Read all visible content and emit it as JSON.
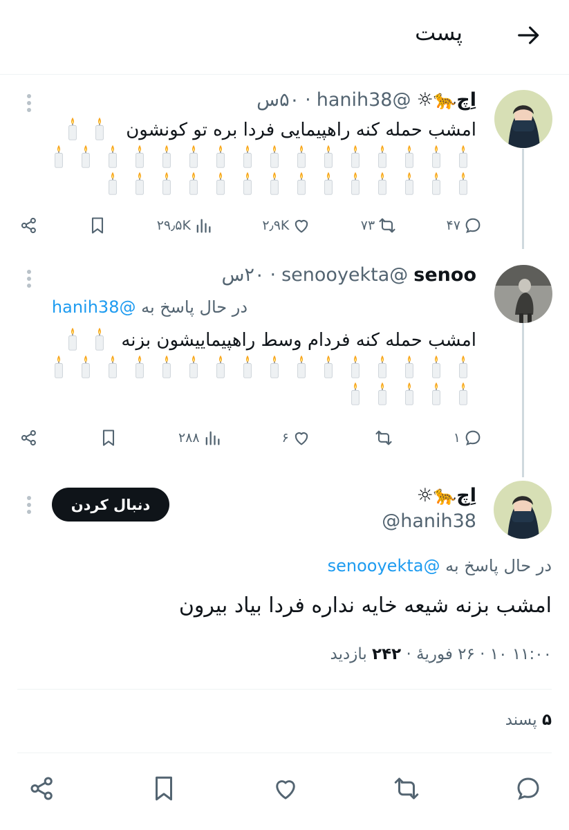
{
  "header": {
    "title": "پست"
  },
  "tweet1": {
    "display_name": "اِچ🐆☼",
    "handle": "@hanih38",
    "time": "۵۰س",
    "text": "امشب حمله کنه راهپیمایی فردا بره تو کونشون",
    "candle_glyph": "🕯️",
    "candle_count": 32,
    "stats": {
      "replies": "۴۷",
      "retweets": "۷۳",
      "likes": "۲٫۹K",
      "views": "۲۹٫۵K"
    }
  },
  "tweet2": {
    "display_name": "senoo",
    "handle": "@senooyekta",
    "time": "۲۰س",
    "reply_prefix": "در حال پاسخ به",
    "reply_to": "@hanih38",
    "text": "امشب حمله کنه فردام وسط راهپیماییشون بزنه",
    "candle_count": 23,
    "stats": {
      "replies": "۱",
      "retweets": "",
      "likes": "۶",
      "views": "۲۸۸"
    }
  },
  "main_tweet": {
    "display_name": "اِچ🐆☼",
    "handle": "@hanih38",
    "follow_label": "دنبال کردن",
    "reply_prefix": "در حال پاسخ به",
    "reply_to": "@senooyekta",
    "text": "امشب بزنه شیعه خایه نداره فردا بیاد بیرون",
    "timestamp": "۱۱:۰۰ ۱۰ · ۲۶ فوریهٔ",
    "views_count": "۲۴۲",
    "views_label": "بازدید",
    "likes_count": "۵",
    "likes_label": "پسند"
  },
  "colors": {
    "accent": "#1d9bf0",
    "muted": "#536471",
    "text": "#0f1419",
    "divider": "#eff3f4"
  }
}
